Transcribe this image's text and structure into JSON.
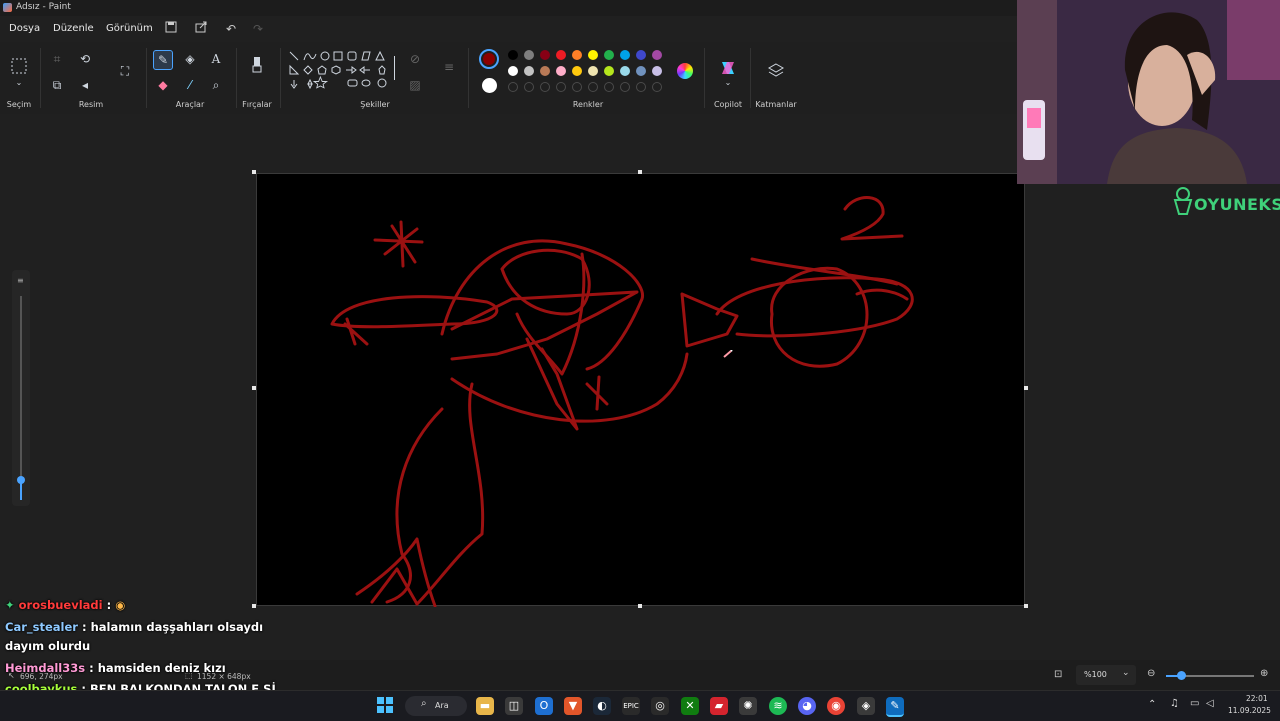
{
  "window": {
    "title": "Adsız - Paint"
  },
  "menu": {
    "file": "Dosya",
    "edit": "Düzenle",
    "view": "Görünüm"
  },
  "ribbon": {
    "groups": {
      "selection": "Seçim",
      "image": "Resim",
      "tools": "Araçlar",
      "brushes": "Fırçalar",
      "shapes": "Şekiller",
      "colors": "Renkler",
      "copilot": "Copilot",
      "layers": "Katmanlar"
    },
    "active_color": "#8b0000",
    "secondary_color": "#ffffff",
    "palette_row1": [
      "#000000",
      "#7f7f7f",
      "#880015",
      "#ed1c24",
      "#ff7f27",
      "#fff200",
      "#22b14c",
      "#00a2e8",
      "#3f48cc",
      "#a349a4"
    ],
    "palette_row2": [
      "#ffffff",
      "#c3c3c3",
      "#b97a57",
      "#ffaec9",
      "#ffc90e",
      "#efe4b0",
      "#b5e61d",
      "#99d9ea",
      "#7092be",
      "#c8bfe7"
    ]
  },
  "canvas": {
    "stroke_color": "#9b1111",
    "background": "#000000"
  },
  "status": {
    "cursor_position": "696, 274px",
    "canvas_size": "1152 × 648px",
    "zoom": "%100"
  },
  "overlay": {
    "brand": "OYUNEKS",
    "chat": [
      {
        "user": "orosbuevladi",
        "text": "",
        "user_color": "#ff3b3b"
      },
      {
        "user": "Car_stealer",
        "text": "halamın daşşahları olsaydı dayım olurdu",
        "user_color": "#8ec9ff"
      },
      {
        "user": "Heimdall33s",
        "text": "hamsiden deniz kızı",
        "user_color": "#ff9ad5"
      },
      {
        "user": "coolbaykus",
        "text": "BEN BALKONDAN TALON E Sİ ATMAYA GİDİYORUM",
        "user_color": "#a8ff3b"
      }
    ]
  },
  "taskbar": {
    "search_label": "Ara",
    "time": "22:01",
    "date": "11.09.2025"
  }
}
